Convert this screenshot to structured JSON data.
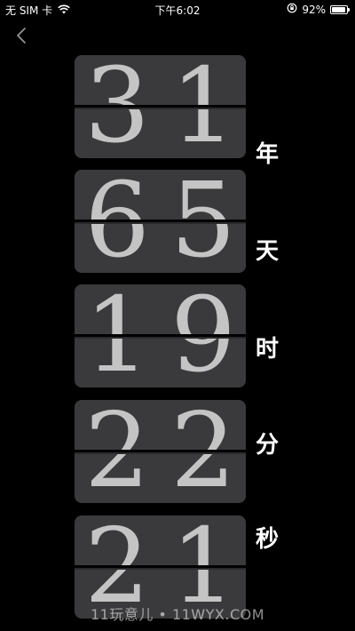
{
  "status_bar": {
    "carrier": "无 SIM 卡",
    "time": "下午6:02",
    "battery_text": "92%",
    "battery_level": 0.92
  },
  "counter": [
    {
      "digits": [
        "3",
        "1"
      ],
      "unit": "年"
    },
    {
      "digits": [
        "6",
        "5"
      ],
      "unit": "天"
    },
    {
      "digits": [
        "1",
        "9"
      ],
      "unit": "时"
    },
    {
      "digits": [
        "2",
        "2"
      ],
      "unit": "分"
    },
    {
      "digits": [
        "2",
        "1"
      ],
      "unit": "秒"
    }
  ],
  "watermark": "11玩意儿 • 11WYX.COM",
  "icons": {
    "wifi": "wifi-icon",
    "lock_rotation": "orientation-lock-icon",
    "battery": "battery-icon",
    "back": "back-chevron-icon"
  }
}
